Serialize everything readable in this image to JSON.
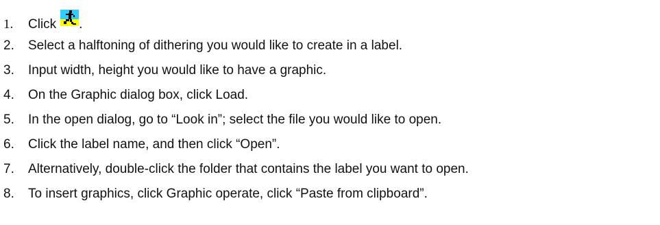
{
  "steps": [
    {
      "number": "1.",
      "text": "Click",
      "icon": "running-man-icon",
      "suffix": "."
    },
    {
      "number": "2.",
      "text": "Select a halftoning of dithering you would like to create in a label."
    },
    {
      "number": "3.",
      "text": "Input width, height you would like to have a graphic."
    },
    {
      "number": "4.",
      "text": "On the Graphic dialog box, click Load."
    },
    {
      "number": "5.",
      "text": "In the open dialog, go to “Look in”; select the file you would like to open."
    },
    {
      "number": "6.",
      "text": "Click the label name, and then click “Open”."
    },
    {
      "number": "7.",
      "text": "Alternatively, double-click the folder that contains the label you want to open."
    },
    {
      "number": "8.",
      "text": "To insert graphics, click Graphic operate, click “Paste from clipboard”."
    }
  ],
  "icon_colors": {
    "sky": "#33CCFF",
    "ground": "#FFFF00",
    "figure": "#000000"
  }
}
